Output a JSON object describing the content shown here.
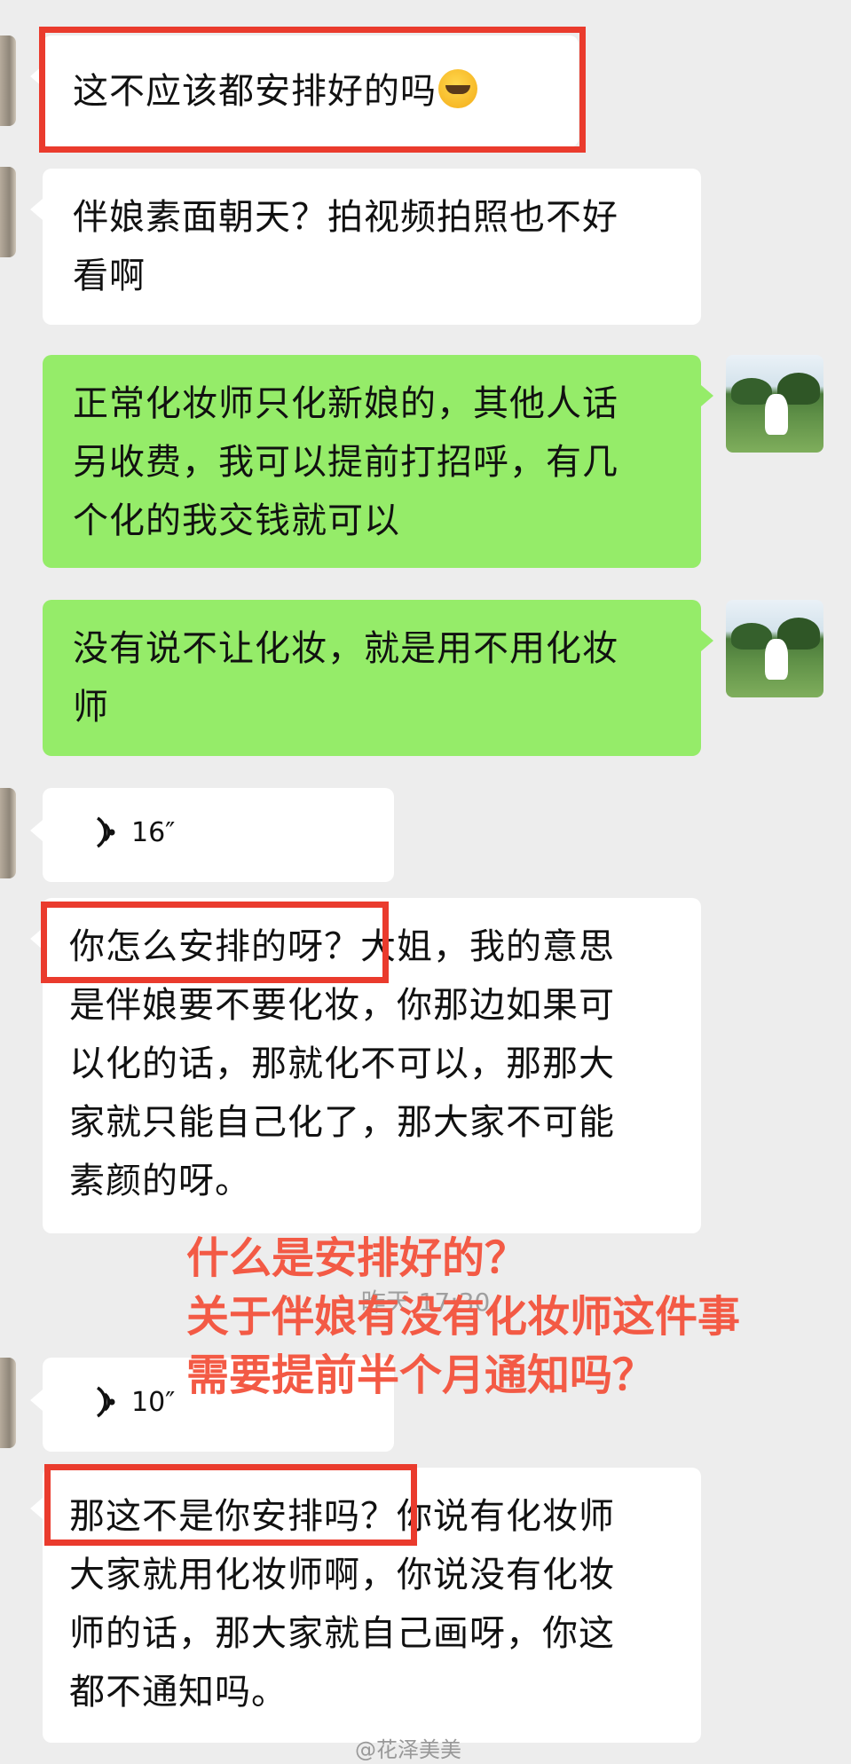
{
  "messages": [
    {
      "kind": "text",
      "side": "left",
      "text": "这不应该都安排好的吗"
    },
    {
      "kind": "text",
      "side": "left",
      "lines": [
        "伴娘素面朝天？拍视频拍照也不好",
        "看啊"
      ]
    },
    {
      "kind": "text",
      "side": "right",
      "lines": [
        "正常化妆师只化新娘的，其他人话",
        "另收费，我可以提前打招呼，有几",
        "个化的我交钱就可以"
      ]
    },
    {
      "kind": "text",
      "side": "right",
      "lines": [
        "没有说不让化妆，就是用不用化妆",
        "师"
      ]
    },
    {
      "kind": "voice",
      "side": "left",
      "duration": "16″"
    },
    {
      "kind": "text",
      "side": "left",
      "lines": [
        "你怎么安排的呀？大姐，我的意思",
        "是伴娘要不要化妆，你那边如果可",
        "以化的话，那就化不可以，那那大",
        "家就只能自己化了，那大家不可能",
        "素颜的呀。"
      ]
    },
    {
      "kind": "voice",
      "side": "left",
      "duration": "10″"
    },
    {
      "kind": "text",
      "side": "left",
      "lines": [
        "那这不是你安排吗？你说有化妆师",
        "大家就用化妆师啊，你说没有化妆",
        "师的话，那大家就自己画呀，你这",
        "都不通知吗。"
      ]
    }
  ],
  "timestamp": "昨天 17:30",
  "annotation": [
    "什么是安排好的？",
    "关于伴娘有没有化妆师这件事",
    "需要提前半个月通知吗？"
  ],
  "watermark": "@花泽美美",
  "colors": {
    "highlight": "#ea3b2d",
    "annotation": "#f35a45",
    "green_bubble": "#95ec69"
  }
}
